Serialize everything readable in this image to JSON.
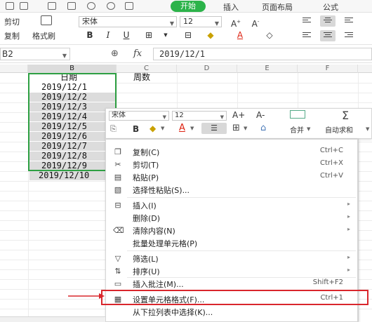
{
  "tabs": {
    "home": "开始",
    "insert": "插入",
    "page_layout": "页面布局",
    "formulas": "公式"
  },
  "ribbon": {
    "cut": "剪切",
    "copy": "复制",
    "format_painter": "格式刷",
    "font_name": "宋体",
    "font_size": "12"
  },
  "formula_bar": {
    "name_box": "B2",
    "fx_label": "fx",
    "formula": "2019/12/1"
  },
  "columns": [
    "B",
    "C",
    "D",
    "E",
    "F"
  ],
  "cells": {
    "b_header": "日期",
    "c_header": "周数",
    "dates": [
      "2019/12/1",
      "2019/12/2",
      "2019/12/3",
      "2019/12/4",
      "2019/12/5",
      "2019/12/6",
      "2019/12/7",
      "2019/12/8",
      "2019/12/9",
      "2019/12/10"
    ]
  },
  "mini_toolbar": {
    "font_name": "宋体",
    "font_size": "12",
    "grow_font": "A+",
    "shrink_font": "A-",
    "bold": "B",
    "merge": "合并",
    "autosum": "自动求和"
  },
  "context_menu": {
    "items": [
      {
        "icon": "copy-icon",
        "label": "复制(C)",
        "shortcut": "Ctrl+C"
      },
      {
        "icon": "scissors-icon",
        "label": "剪切(T)",
        "shortcut": "Ctrl+X"
      },
      {
        "icon": "clipboard-icon",
        "label": "粘贴(P)",
        "shortcut": "Ctrl+V"
      },
      {
        "icon": "paste-special-icon",
        "label": "选择性粘贴(S)...",
        "shortcut": ""
      },
      {
        "icon": "insert-icon",
        "label": "插入(I)",
        "shortcut": ""
      },
      {
        "icon": "",
        "label": "删除(D)",
        "shortcut": ""
      },
      {
        "icon": "eraser-icon",
        "label": "清除内容(N)",
        "shortcut": ""
      },
      {
        "icon": "",
        "label": "批量处理单元格(P)",
        "shortcut": ""
      },
      {
        "icon": "filter-icon",
        "label": "筛选(L)",
        "shortcut": ""
      },
      {
        "icon": "sort-icon",
        "label": "排序(U)",
        "shortcut": ""
      },
      {
        "icon": "comment-icon",
        "label": "插入批注(M)...",
        "shortcut": "Shift+F2"
      },
      {
        "icon": "format-cells-icon",
        "label": "设置单元格格式(F)...",
        "shortcut": "Ctrl+1"
      },
      {
        "icon": "",
        "label": "从下拉列表中选择(K)...",
        "shortcut": ""
      }
    ]
  },
  "colors": {
    "accent_green": "#2cb34a",
    "selection_border": "#2ea043",
    "highlight_red": "#d9262c"
  }
}
